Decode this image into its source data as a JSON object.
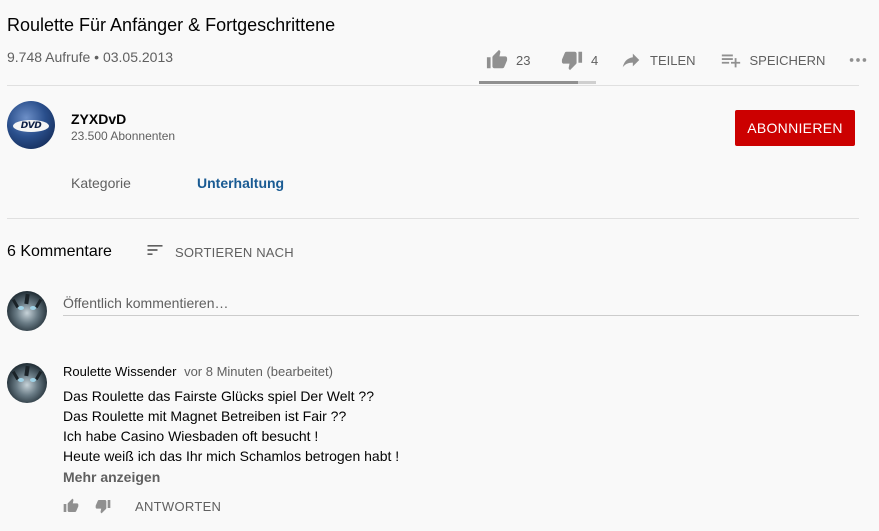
{
  "video": {
    "title": "Roulette Für Anfänger & Fortgeschrittene",
    "views_date": "9.748 Aufrufe • 03.05.2013",
    "likes": "23",
    "dislikes": "4",
    "like_ratio": 0.85,
    "share_label": "TEILEN",
    "save_label": "SPEICHERN"
  },
  "channel": {
    "name": "ZYXDvD",
    "subscribers": "23.500 Abonnenten",
    "avatar_logo": "DVD",
    "subscribe_label": "ABONNIEREN"
  },
  "category": {
    "label": "Kategorie",
    "value": "Unterhaltung"
  },
  "comments": {
    "count_label": "6 Kommentare",
    "sort_label": "SORTIEREN NACH",
    "input_placeholder": "Öffentlich kommentieren…",
    "items": [
      {
        "author": "Roulette Wissender",
        "time": "vor 8 Minuten (bearbeitet)",
        "lines": [
          "Das Roulette das Fairste Glücks spiel Der Welt ??",
          "Das Roulette mit Magnet Betreiben ist Fair ??",
          "Ich habe Casino Wiesbaden oft besucht !",
          "Heute weiß ich das Ihr mich Schamlos betrogen habt !"
        ],
        "more_label": "Mehr anzeigen",
        "reply_label": "ANTWORTEN"
      }
    ]
  },
  "icons": {
    "like": "thumb-up-icon",
    "dislike": "thumb-down-icon",
    "share": "share-arrow-icon",
    "save": "playlist-add-icon",
    "more": "more-horizontal-icon",
    "sort": "sort-lines-icon"
  },
  "colors": {
    "subscribe": "#cc0000",
    "category_link": "#1a5b93"
  }
}
